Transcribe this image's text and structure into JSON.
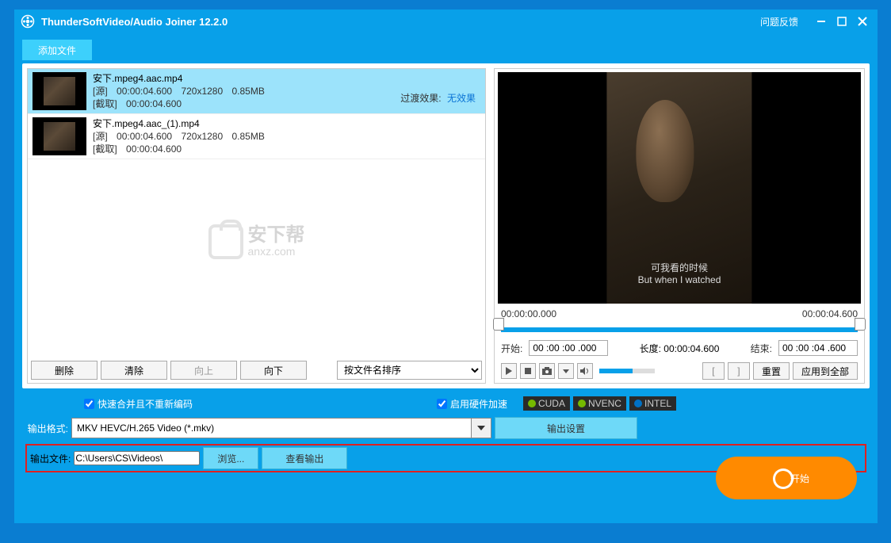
{
  "titlebar": {
    "title": "ThunderSoftVideo/Audio Joiner 12.2.0",
    "feedback": "问题反馈"
  },
  "toolbar": {
    "add_files": "添加文件"
  },
  "files": [
    {
      "name": "安下.mpeg4.aac.mp4",
      "source_label": "[源]",
      "source_duration": "00:00:04.600",
      "resolution": "720x1280",
      "size": "0.85MB",
      "clip_label": "[截取]",
      "clip_duration": "00:00:04.600",
      "selected": true
    },
    {
      "name": "安下.mpeg4.aac_(1).mp4",
      "source_label": "[源]",
      "source_duration": "00:00:04.600",
      "resolution": "720x1280",
      "size": "0.85MB",
      "clip_label": "[截取]",
      "clip_duration": "00:00:04.600",
      "selected": false
    }
  ],
  "transition": {
    "label": "过渡效果:",
    "value": "无效果"
  },
  "list_buttons": {
    "delete": "删除",
    "clear": "清除",
    "up": "向上",
    "down": "向下",
    "sort": "按文件名排序"
  },
  "preview": {
    "time_current": "00:00:00.000",
    "time_total": "00:00:04.600",
    "start_label": "开始:",
    "start_value": "00 :00 :00 .000",
    "length_label": "长度:",
    "length_value": "00:00:04.600",
    "end_label": "结束:",
    "end_value": "00 :00 :04 .600",
    "reset": "重置",
    "apply_all": "应用到全部",
    "subtitle_cn": "可我看的时候",
    "subtitle_en": "But when I watched"
  },
  "options": {
    "fast_merge": "快速合并且不重新编码",
    "hw_accel": "启用硬件加速",
    "badges": [
      "CUDA",
      "NVENC",
      "INTEL"
    ]
  },
  "output": {
    "format_label": "输出格式:",
    "format_value": "MKV HEVC/H.265 Video (*.mkv)",
    "settings_btn": "输出设置",
    "file_label": "输出文件:",
    "file_value": "C:\\Users\\CS\\Videos\\",
    "browse_btn": "浏览...",
    "view_btn": "查看输出"
  },
  "start_btn": "开始",
  "watermark": {
    "cn": "安下帮",
    "en": "anxz.com"
  }
}
